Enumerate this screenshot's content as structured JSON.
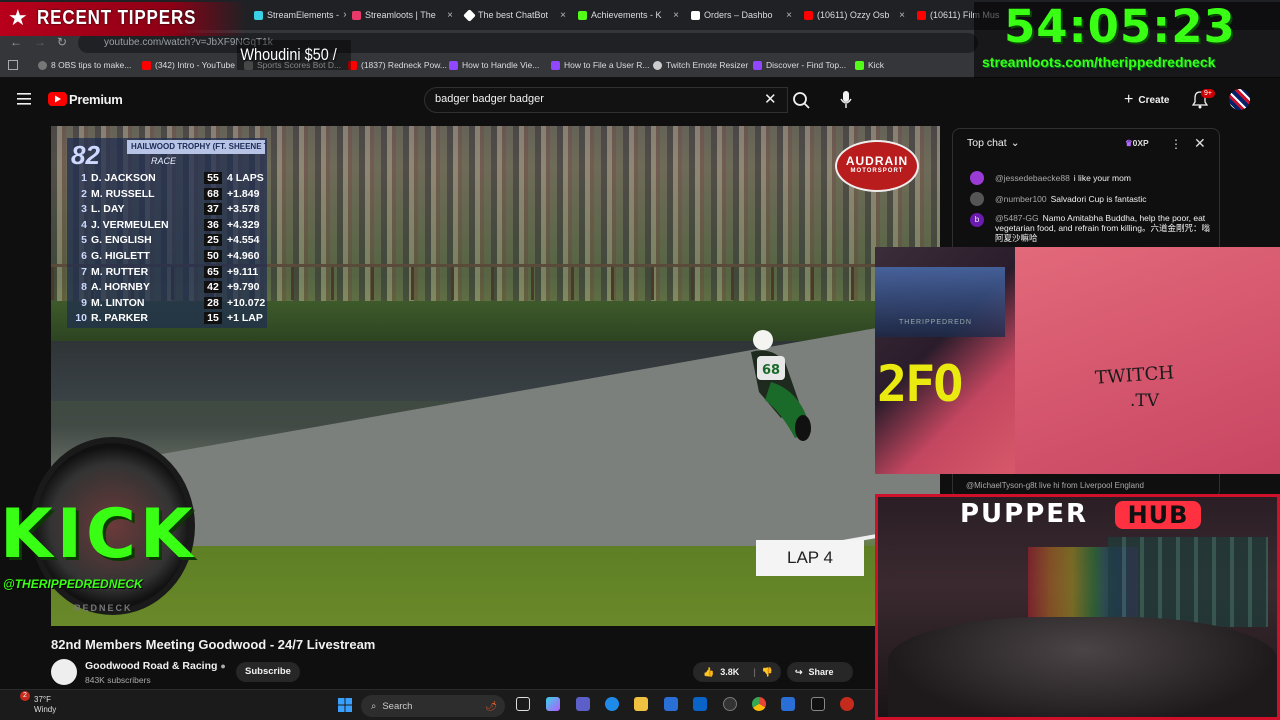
{
  "browser": {
    "tabs": [
      {
        "label": "StreamElements - ",
        "color": "#3ad1e6"
      },
      {
        "label": "Streamloots | The",
        "color": "#e83a6a"
      },
      {
        "label": "The best ChatBot",
        "color": "#ffffff"
      },
      {
        "label": "Achievements - K",
        "color": "#53fc18"
      },
      {
        "label": "Orders – Dashbo",
        "color": "#ffffff"
      },
      {
        "label": "(10611) Ozzy Osb",
        "color": "#ff0000"
      },
      {
        "label": "(10611) Film Mus",
        "color": "#ff0000"
      }
    ],
    "url": "youtube.com/watch?v=JbXF9NGqT1k",
    "bookmarks": [
      {
        "label": "8 OBS tips to make...",
        "color": "#777777"
      },
      {
        "label": "(342) Intro - YouTube",
        "color": "#ff0000"
      },
      {
        "label": "Sports Scores Bot D...",
        "color": "#777777"
      },
      {
        "label": "(1837) Redneck Pow...",
        "color": "#ff0000"
      },
      {
        "label": "How to Handle Vie...",
        "color": "#9146ff"
      },
      {
        "label": "How to File a User R...",
        "color": "#9146ff"
      },
      {
        "label": "Twitch Emote Resizer",
        "color": "#cccccc"
      },
      {
        "label": "Discover - Find Top...",
        "color": "#9146ff"
      },
      {
        "label": "Kick",
        "color": "#53fc18"
      }
    ]
  },
  "youtube": {
    "logo": "Premium",
    "search_value": "badger badger badger",
    "create_label": "Create",
    "notif_count": "9+",
    "video_title": "82nd Members Meeting Goodwood - 24/7 Livestream",
    "channel_name": "Goodwood Road & Racing",
    "subscribers": "843K subscribers",
    "subscribe_label": "Subscribe",
    "likes": "3.8K",
    "share_label": "Share"
  },
  "video": {
    "event_number": "82",
    "race_title": "HAILWOOD TROPHY (FT. SHEENE TROPHY)",
    "race_label": "RACE",
    "leaderboard": [
      {
        "pos": "1",
        "name": "D. JACKSON",
        "num": "55",
        "gap": "4 LAPS"
      },
      {
        "pos": "2",
        "name": "M. RUSSELL",
        "num": "68",
        "gap": "+1.849"
      },
      {
        "pos": "3",
        "name": "L. DAY",
        "num": "37",
        "gap": "+3.578"
      },
      {
        "pos": "4",
        "name": "J. VERMEULEN",
        "num": "36",
        "gap": "+4.329"
      },
      {
        "pos": "5",
        "name": "G. ENGLISH",
        "num": "25",
        "gap": "+4.554"
      },
      {
        "pos": "6",
        "name": "G. HIGLETT",
        "num": "50",
        "gap": "+4.960"
      },
      {
        "pos": "7",
        "name": "M. RUTTER",
        "num": "65",
        "gap": "+9.111"
      },
      {
        "pos": "8",
        "name": "A. HORNBY",
        "num": "42",
        "gap": "+9.790"
      },
      {
        "pos": "9",
        "name": "M. LINTON",
        "num": "28",
        "gap": "+10.072"
      },
      {
        "pos": "10",
        "name": "R. PARKER",
        "num": "15",
        "gap": "+1 LAP"
      }
    ],
    "sponsor": "AUDRAIN",
    "sponsor_sub": "MOTORSPORT",
    "bike_number": "68",
    "lap_label": "LAP 4"
  },
  "chat": {
    "mode_label": "Top chat",
    "xp_label": "0XP",
    "messages": [
      {
        "author": "@jessedebaecke88",
        "text": "i like your mom",
        "color": "#9a3bd6"
      },
      {
        "author": "@number100",
        "text": "Salvadori Cup is fantastic",
        "color": "#555555"
      },
      {
        "author": "@5487-GG",
        "text": "Namo Amitabha Buddha, help the poor, eat vegetarian food, and refrain from killing。六道金剛咒：嗡阿夏沙嘛哈",
        "color": "#6a1bb0",
        "initial": "b"
      }
    ],
    "peek_message": "@MichaelTyson-g8t  live hi from Liverpool England"
  },
  "overlays": {
    "recent_tippers": "RECENT TIPPERS",
    "tipper": "Whoudini $50 /",
    "timer": "54:05:23",
    "streamloots_url": "streamloots.com/therippedredneck",
    "kick_logo": "KICK",
    "kick_handle": "@THERIPPEDREDNECK",
    "kick_sub": "REDNECK",
    "pupper": "PUPPER",
    "hub": "HUB",
    "cam_text_1": "TWITCH",
    "cam_text_2": ".TV",
    "cam_yellow": "2FO",
    "cam_monitor": "THERIPPEDREDN"
  },
  "taskbar": {
    "temp": "37°F",
    "condition": "Windy",
    "search_placeholder": "Search",
    "weather_badge": "2"
  }
}
